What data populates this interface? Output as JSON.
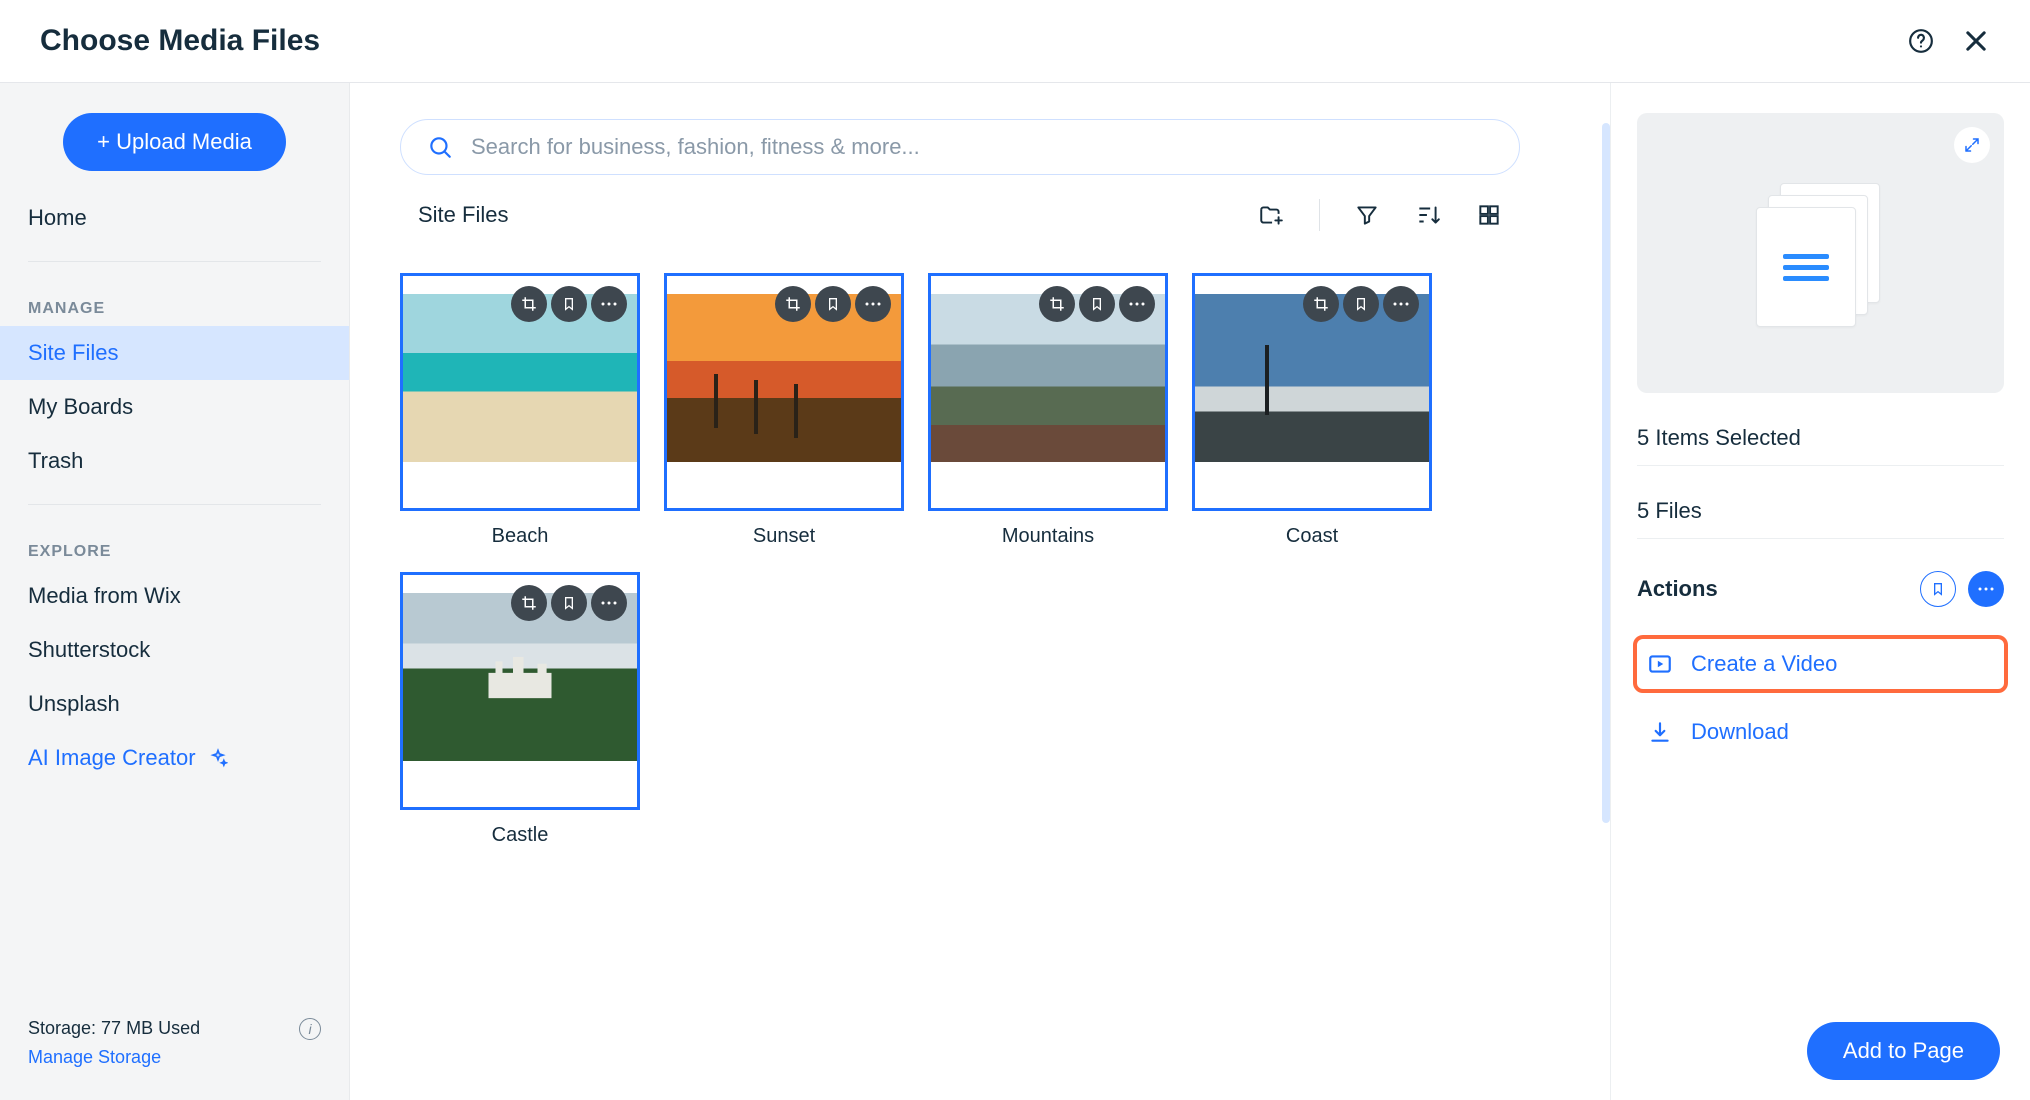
{
  "header": {
    "title": "Choose Media Files"
  },
  "sidebar": {
    "upload_label": "+ Upload Media",
    "home_label": "Home",
    "manage_label": "MANAGE",
    "manage_items": [
      "Site Files",
      "My Boards",
      "Trash"
    ],
    "explore_label": "EXPLORE",
    "explore_items": [
      "Media from Wix",
      "Shutterstock",
      "Unsplash"
    ],
    "ai_creator_label": "AI Image Creator",
    "storage_used": "Storage: 77 MB Used",
    "manage_storage": "Manage Storage"
  },
  "main": {
    "search_placeholder": "Search for business, fashion, fitness & more...",
    "breadcrumb": "Site Files",
    "items": [
      {
        "label": "Beach"
      },
      {
        "label": "Sunset"
      },
      {
        "label": "Mountains"
      },
      {
        "label": "Coast"
      },
      {
        "label": "Castle"
      }
    ]
  },
  "details": {
    "selected_count": "5 Items Selected",
    "files_count": "5 Files",
    "actions_label": "Actions",
    "create_video": "Create a Video",
    "download": "Download"
  },
  "footer": {
    "add_to_page": "Add to Page"
  }
}
